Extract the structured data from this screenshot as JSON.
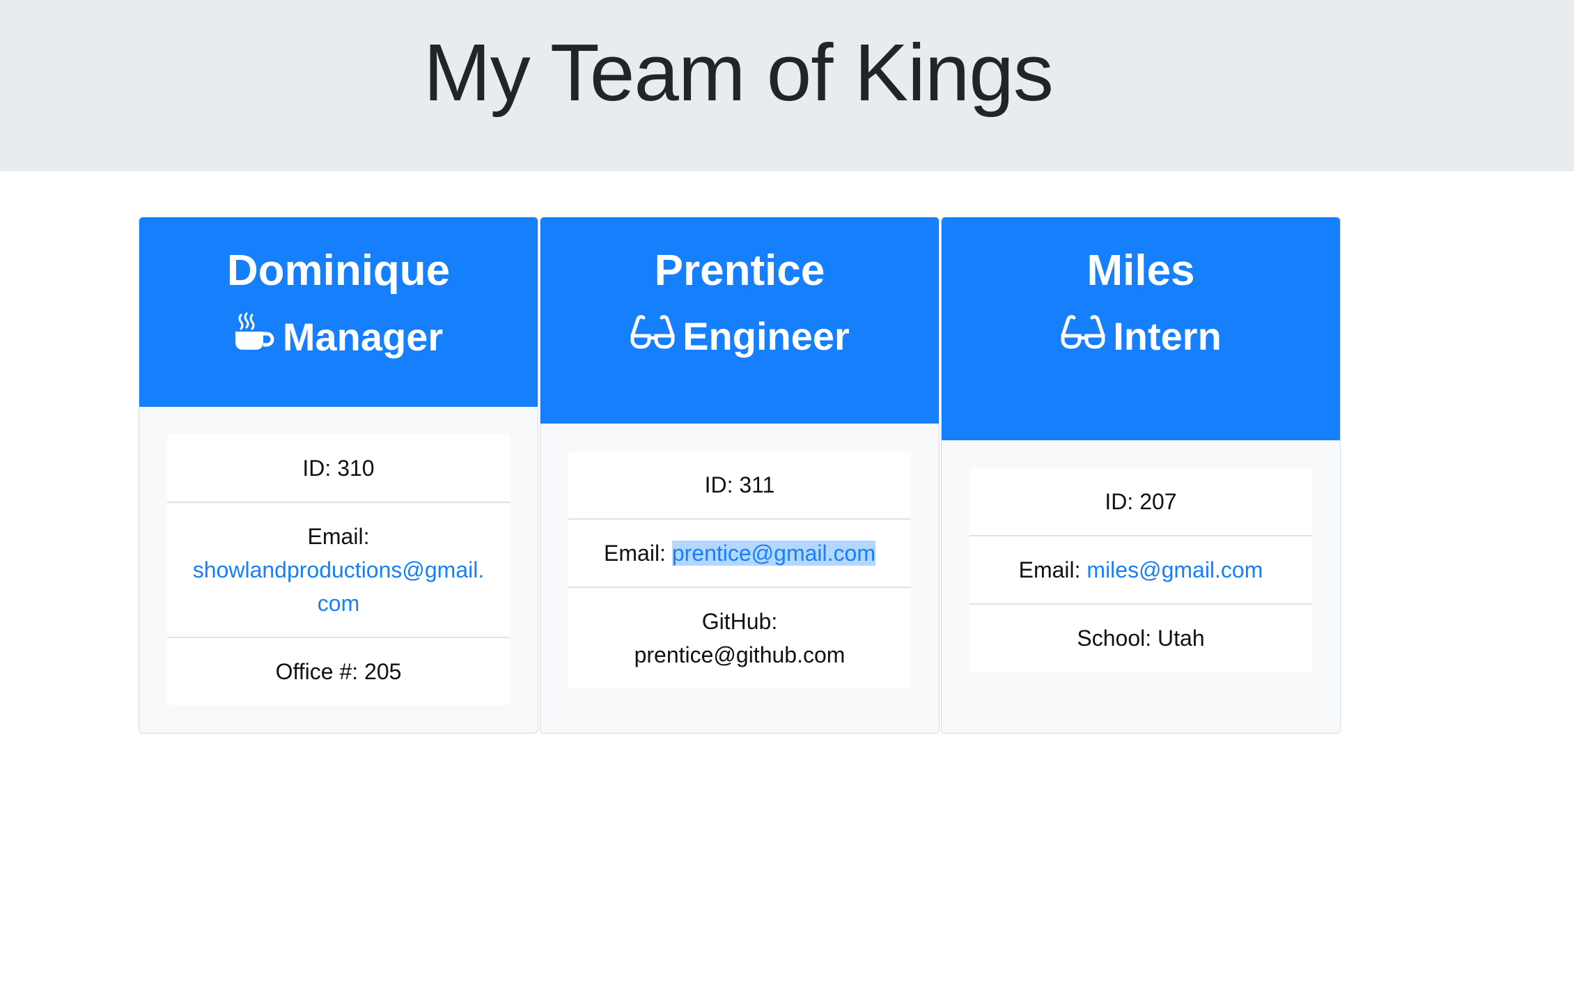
{
  "header": {
    "title": "My Team of Kings"
  },
  "employees": [
    {
      "name": "Dominique",
      "role": "Manager",
      "role_icon": "coffee-icon",
      "id_label": "ID: ",
      "id": "310",
      "email_label": "Email: ",
      "email": "showlandproductions@gmail.com",
      "extra_label": "Office #: ",
      "extra_value": "205"
    },
    {
      "name": "Prentice",
      "role": "Engineer",
      "role_icon": "glasses-icon",
      "id_label": "ID: ",
      "id": "311",
      "email_label": "Email: ",
      "email": "prentice@gmail.com",
      "extra_label": "GitHub: ",
      "extra_value": "prentice@github.com"
    },
    {
      "name": "Miles",
      "role": "Intern",
      "role_icon": "glasses-icon",
      "id_label": "ID: ",
      "id": "207",
      "email_label": "Email: ",
      "email": "miles@gmail.com",
      "extra_label": "School: ",
      "extra_value": "Utah"
    }
  ],
  "colors": {
    "jumbotron_bg": "#e9ecef",
    "card_header_bg": "#1680fc",
    "link": "#1680fc",
    "selection_highlight": "#b3d7ff"
  }
}
